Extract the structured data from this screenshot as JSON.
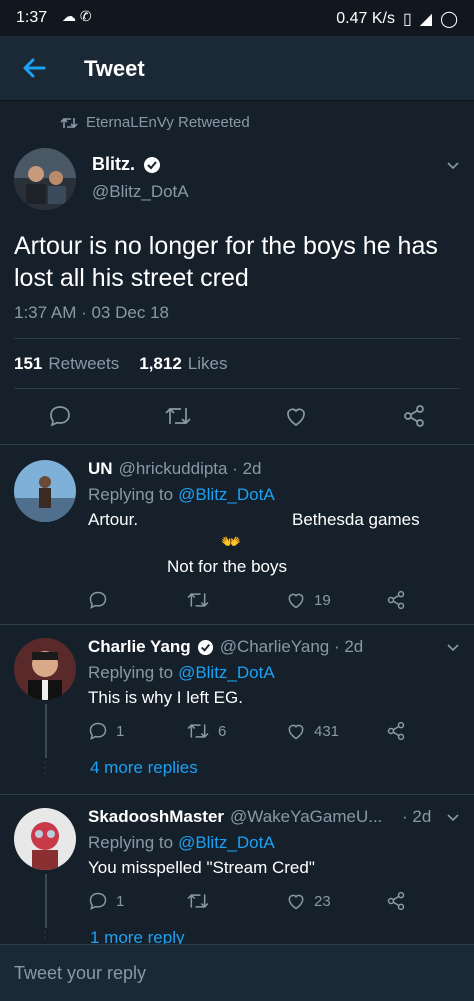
{
  "status": {
    "time": "1:37",
    "speed": "0.47 K/s"
  },
  "header": {
    "title": "Tweet"
  },
  "retweet_line": "EternaLEnVy Retweeted",
  "main_tweet": {
    "name": "Blitz.",
    "handle": "@Blitz_DotA",
    "text_line1": "Artour is no longer for the boys he has",
    "text_line2": "lost all his street cred",
    "timestamp": "1:37 AM · 03 Dec 18",
    "retweets_count": "151",
    "retweets_label": "Retweets",
    "likes_count": "1,812",
    "likes_label": "Likes"
  },
  "replies": [
    {
      "name": "UN",
      "handle_time": "@hrickuddipta · 2d",
      "replying_prefix": "Replying to",
      "replying_to": "@Blitz_DotA",
      "line1_left": "Artour.",
      "line1_right": "Bethesda games",
      "emoji": "👐",
      "line2": "Not for the boys",
      "reply_count": "",
      "rt_count": "",
      "like_count": "19"
    },
    {
      "name": "Charlie Yang",
      "handle_time": "@CharlieYang · 2d",
      "replying_prefix": "Replying to",
      "replying_to": "@Blitz_DotA",
      "text": "This is why I left EG.",
      "reply_count": "1",
      "rt_count": "6",
      "like_count": "431",
      "more": "4 more replies"
    },
    {
      "name": "SkadooshMaster",
      "handle": "@WakeYaGameU...",
      "time": "· 2d",
      "replying_prefix": "Replying to",
      "replying_to": "@Blitz_DotA",
      "text": "You misspelled \"Stream Cred\"",
      "reply_count": "1",
      "rt_count": "",
      "like_count": "23",
      "more": "1 more reply"
    }
  ],
  "reply_bar": {
    "placeholder": "Tweet your reply"
  },
  "colors": {
    "bg": "#15202b",
    "accent": "#1da1f2",
    "muted": "#8899a6"
  }
}
